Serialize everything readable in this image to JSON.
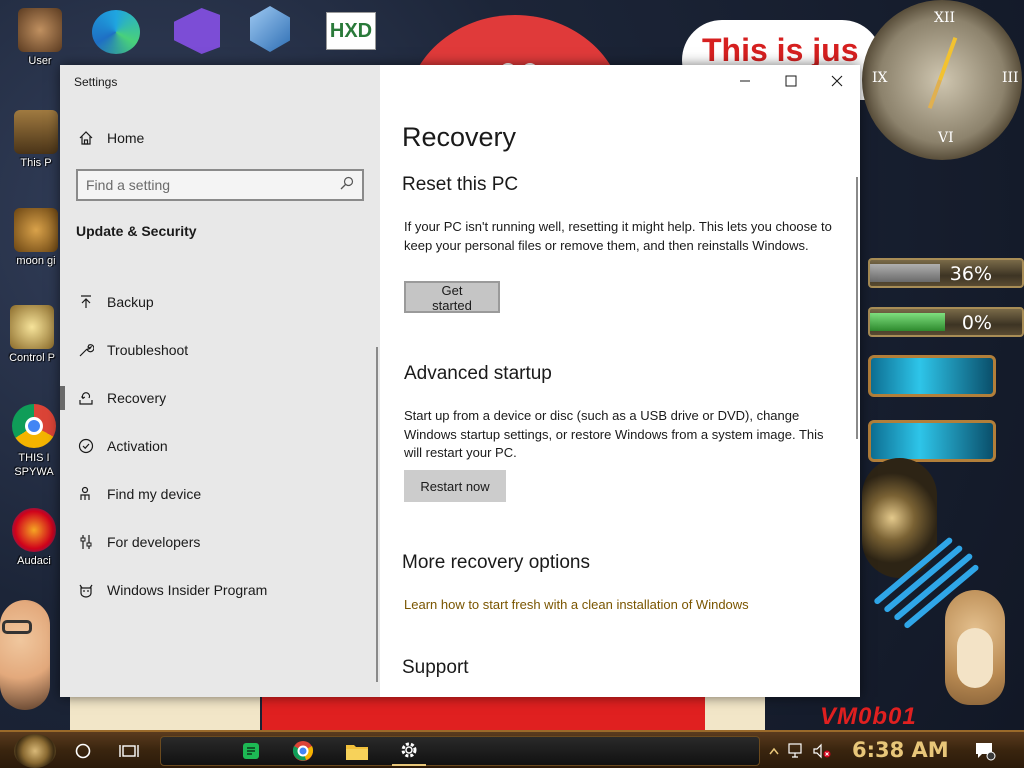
{
  "window": {
    "title": "Settings",
    "controls": {
      "minimize": "minimize",
      "maximize": "maximize",
      "close": "close"
    }
  },
  "nav": {
    "home_label": "Home",
    "search_placeholder": "Find a setting",
    "section_label": "Update & Security",
    "items": [
      {
        "label": "Backup",
        "icon": "backup-arrow-icon"
      },
      {
        "label": "Troubleshoot",
        "icon": "wrench-icon"
      },
      {
        "label": "Recovery",
        "icon": "recovery-icon",
        "selected": true
      },
      {
        "label": "Activation",
        "icon": "check-circle-icon"
      },
      {
        "label": "Find my device",
        "icon": "person-pin-icon"
      },
      {
        "label": "For developers",
        "icon": "sliders-icon"
      },
      {
        "label": "Windows Insider Program",
        "icon": "insider-cat-icon"
      }
    ]
  },
  "content": {
    "page_title": "Recovery",
    "reset": {
      "heading": "Reset this PC",
      "body": "If your PC isn't running well, resetting it might help. This lets you choose to keep your personal files or remove them, and then reinstalls Windows.",
      "button": "Get started"
    },
    "advanced": {
      "heading": "Advanced startup",
      "body": "Start up from a device or disc (such as a USB drive or DVD), change Windows startup settings, or restore Windows from a system image. This will restart your PC.",
      "button": "Restart now"
    },
    "more": {
      "heading": "More recovery options",
      "link": "Learn how to start fresh with a clean installation of Windows"
    },
    "support": {
      "heading": "Support"
    }
  },
  "desktop": {
    "icons": [
      {
        "label": "User"
      },
      {
        "label": "This P"
      },
      {
        "label": "moon gi"
      },
      {
        "label": "Control P"
      },
      {
        "label": "THIS I SPYWA"
      },
      {
        "label": "Audaci"
      }
    ],
    "wallpaper": {
      "bubble_text": "This is jus",
      "meter_1": "36%",
      "meter_2": "0%",
      "brand": "VM0b01"
    }
  },
  "taskbar": {
    "clock": "6:38 AM",
    "apps": [
      "search-circle-icon",
      "task-view-icon",
      "notes-app-icon",
      "chrome-icon",
      "file-explorer-icon",
      "settings-gear-icon"
    ]
  },
  "colors": {
    "accent_link": "#7a5500",
    "nav_bg": "#e8e8e8",
    "button_bg": "#cccccc"
  }
}
